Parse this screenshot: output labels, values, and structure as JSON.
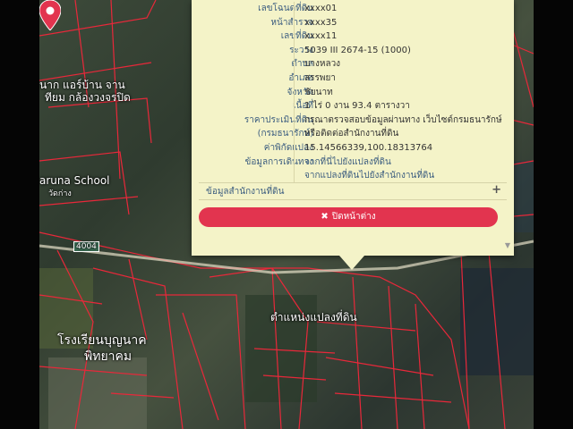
{
  "popup": {
    "rows": [
      {
        "label": "เลขโฉนดที่ดิน",
        "value": "xxxx01"
      },
      {
        "label": "หน้าสำรวจ",
        "value": "xxxx35"
      },
      {
        "label": "เลขที่ดิน",
        "value": "xxxx11"
      },
      {
        "label": "ระวาง",
        "value": "5039 III 2674-15 (1000)"
      },
      {
        "label": "ตำบล",
        "value": "บางหลวง"
      },
      {
        "label": "อำเภอ",
        "value": "สรรพยา"
      },
      {
        "label": "จังหวัด",
        "value": "ชัยนาท"
      },
      {
        "label": "เนื้อที่",
        "value": "1 ไร่ 0 งาน 93.4 ตารางวา"
      },
      {
        "label": "ราคาประเมินที่ดิน",
        "value": "กรุณาตรวจสอบข้อมูลผ่านทาง เว็บไซต์กรมธนารักษ์"
      },
      {
        "label": "(กรมธนารักษ์)",
        "value": "หรือติดต่อสำนักงานที่ดิน"
      },
      {
        "label": "ค่าพิกัดแปลง",
        "value": "15.14566339,100.18313764"
      },
      {
        "label": "ข้อมูลการเดินทาง",
        "value": "จากที่นี่ไปยังแปลงที่ดิน"
      },
      {
        "label": "",
        "value": "จากแปลงที่ดินไปยังสำนักงานที่ดิน"
      }
    ],
    "section_label": "ข้อมูลสำนักงานที่ดิน",
    "close_label": "ปิดหน้าต่าง"
  },
  "map": {
    "labels": {
      "village": "นาก แอร์บ้าน จาน",
      "village2": "ทียม กล้องวงจรปิด",
      "school_en": "aruna School",
      "school_en2": "วัดก่าง",
      "road": "4004",
      "parcel": "ตำแหน่งแปลงที่ดิน",
      "school_th1": "โรงเรียนบุญนาค",
      "school_th2": "พิทยาคม"
    }
  },
  "colors": {
    "popup_bg": "#f4f3c8",
    "close_button": "#e2344f",
    "parcel_lines": "#e8283a",
    "label_text": "#3d5e80"
  }
}
